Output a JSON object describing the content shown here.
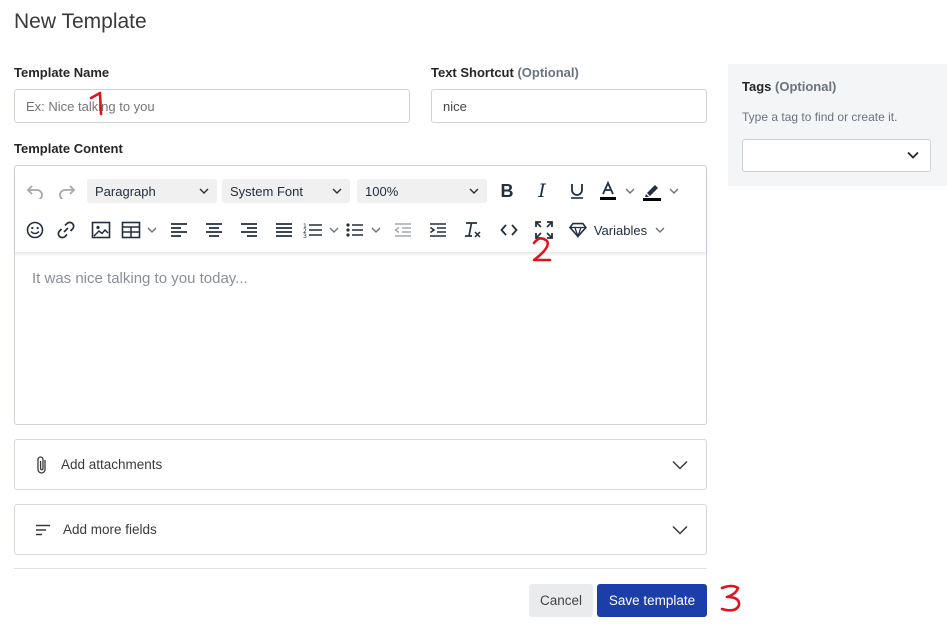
{
  "page": {
    "title": "New Template"
  },
  "template_name": {
    "label": "Template Name",
    "placeholder": "Ex: Nice talking to you",
    "value": ""
  },
  "text_shortcut": {
    "label": "Text Shortcut",
    "optional": "(Optional)",
    "value": "nice"
  },
  "content": {
    "label": "Template Content",
    "block_format": "Paragraph",
    "font_family": "System Font",
    "font_size": "100%",
    "variables_label": "Variables",
    "placeholder": "It was nice talking to you today..."
  },
  "attachments": {
    "label": "Add attachments"
  },
  "more_fields": {
    "label": "Add more fields"
  },
  "actions": {
    "cancel": "Cancel",
    "save": "Save template"
  },
  "tags": {
    "label": "Tags",
    "optional": "(Optional)",
    "hint": "Type a tag to find or create it.",
    "value": ""
  },
  "annotations": {
    "one": "1",
    "two": "2",
    "three": "3",
    "color": "#e0141e"
  }
}
